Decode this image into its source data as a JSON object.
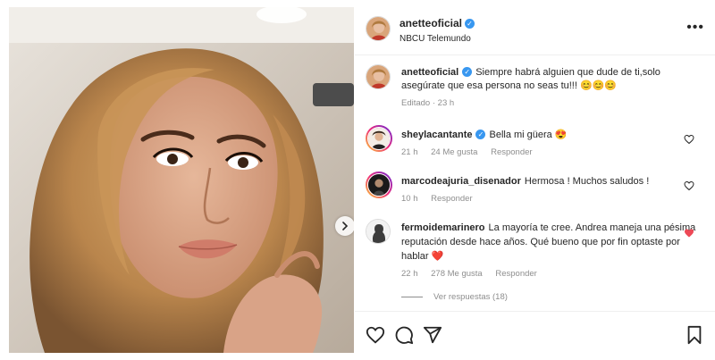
{
  "post": {
    "author": "anetteoficial",
    "location": "NBCU Telemundo",
    "more_icon": "more-options-icon",
    "caption": "Siempre habrá alguien que dude de ti,solo asegúrate que esa persona no seas tu!!! 😊😊😊",
    "caption_meta": "Editado · 23 h"
  },
  "comments": [
    {
      "user": "sheylacantante",
      "verified": true,
      "text": "Bella mi güera 😍",
      "time": "21 h",
      "likes": "24 Me gusta",
      "reply": "Responder",
      "liked": false
    },
    {
      "user": "marcodeajuria_disenador",
      "verified": false,
      "text": "Hermosa ! Muchos saludos !",
      "time": "10 h",
      "likes": "",
      "reply": "Responder",
      "liked": false
    },
    {
      "user": "fermoidemarinero",
      "verified": false,
      "text": "La mayoría te cree. Andrea maneja una pésima reputación desde hace años. Qué bueno que por fin optaste por hablar ❤️",
      "time": "22 h",
      "likes": "278 Me gusta",
      "reply": "Responder",
      "liked": true
    }
  ],
  "view_replies": "Ver respuestas (18)",
  "actions": {
    "like_icon": "heart-icon",
    "comment_icon": "comment-icon",
    "share_icon": "share-icon",
    "save_icon": "bookmark-icon"
  },
  "colors": {
    "verified": "#3897f0",
    "liked_heart": "#ed4956",
    "secondary_text": "#8e8e8e"
  }
}
